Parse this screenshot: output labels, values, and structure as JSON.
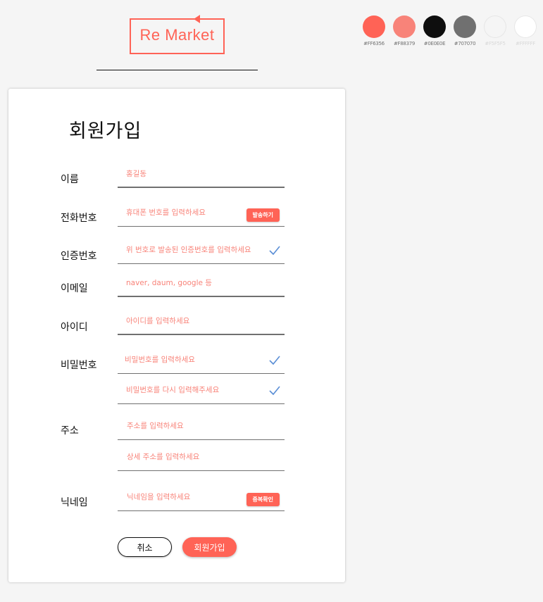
{
  "brand": {
    "logo_text": "Re Market",
    "accent": "#ff6356"
  },
  "palette": [
    {
      "hex": "#ff6356",
      "label": "#FF6356"
    },
    {
      "hex": "#f88379",
      "label": "#F88379"
    },
    {
      "hex": "#0e0e0e",
      "label": "#0E0E0E"
    },
    {
      "hex": "#707070",
      "label": "#707070"
    },
    {
      "hex": "#f5f5f5",
      "label": "#F5F5F5"
    },
    {
      "hex": "#ffffff",
      "label": "#FFFFFF"
    }
  ],
  "form": {
    "title": "회원가입",
    "name": {
      "label": "이름",
      "placeholder": "홍길동"
    },
    "phone": {
      "label": "전화번호",
      "placeholder": "휴대폰 번호를 입력하세요",
      "button": "발송하기"
    },
    "verify": {
      "label": "인증번호",
      "placeholder": "위 번호로 발송된 인증번호를 입력하세요"
    },
    "email": {
      "label": "이메일",
      "placeholder": "naver, daum, google 등"
    },
    "userid": {
      "label": "아이디",
      "placeholder": "아이디를 입력하세요"
    },
    "password": {
      "label": "비밀번호",
      "placeholder": "비밀번호를 입력하세요",
      "confirm_placeholder": "비밀번호를 다시 입력해주세요"
    },
    "address": {
      "label": "주소",
      "placeholder": "주소를 입력하세요",
      "detail_placeholder": "상세 주소를 입력하세요"
    },
    "nickname": {
      "label": "닉네임",
      "placeholder": "닉네임을 입력하세요",
      "button": "중복확인"
    },
    "cancel_label": "취소",
    "submit_label": "회원가입",
    "check_color": "#5b8fd6"
  }
}
